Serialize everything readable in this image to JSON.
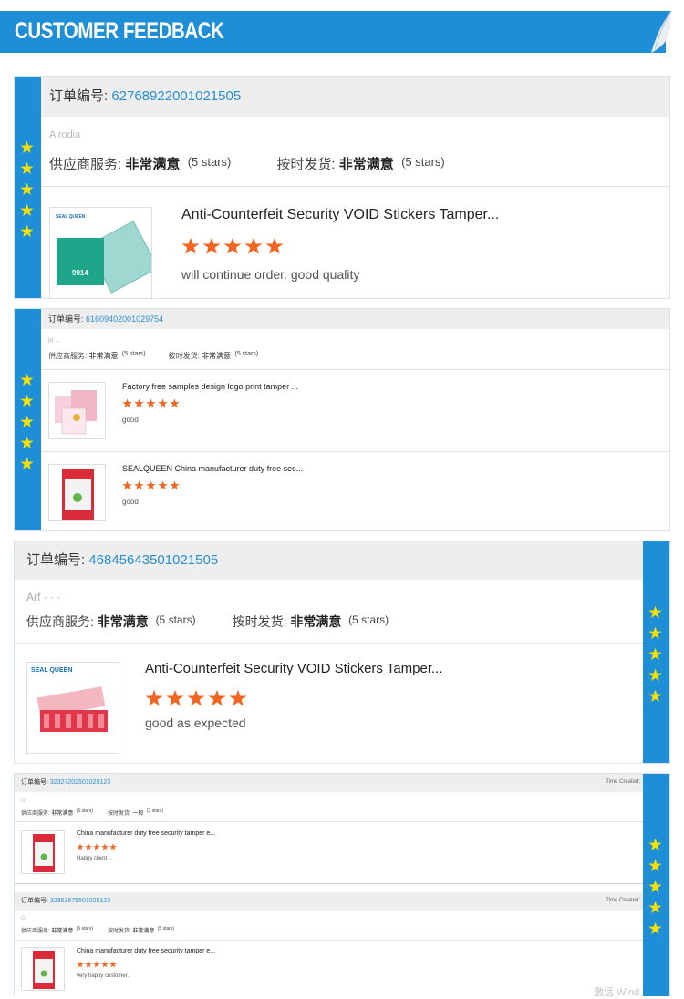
{
  "banner": {
    "title": "CUSTOMER FEEDBACK"
  },
  "labels": {
    "order_label": "订单编号:",
    "supplier_label": "供应商服务:",
    "shipping_label": "按时发货:",
    "very_satisfied": "非常满意",
    "average": "一般",
    "five_stars": "(5 stars)",
    "three_stars": "(3 stars)",
    "time_created": "Time Created:"
  },
  "reviews": [
    {
      "order_no": "62768922001021505",
      "buyer": "A                 rodia",
      "supplier_rating": 5,
      "shipping_rating": 5,
      "items": [
        {
          "title": "Anti-Counterfeit Security VOID Stickers Tamper...",
          "stars": 5,
          "comment": "will continue order. good quality",
          "thumb_text": "SEAL QUEEN",
          "thumb_code": "9914"
        }
      ]
    },
    {
      "order_no": "61609402001029754",
      "buyer": "ja         ...",
      "supplier_rating": 5,
      "shipping_rating": 5,
      "items": [
        {
          "title": "Factory free samples design logo print tamper ...",
          "stars": 5,
          "comment": "good"
        },
        {
          "title": "SEALQUEEN China manufacturer duty free sec...",
          "stars": 5,
          "comment": "good"
        }
      ]
    },
    {
      "order_no": "46845643501021505",
      "buyer": "Arf       ·     ·   ·",
      "supplier_rating": 5,
      "shipping_rating": 5,
      "items": [
        {
          "title": "Anti-Counterfeit Security VOID Stickers Tamper...",
          "stars": 5,
          "comment": "good as expected",
          "thumb_text": "SEAL QUEEN"
        }
      ]
    },
    {
      "order_no": "32327202501025123",
      "buyer": "Gi    ·",
      "supplier_rating": 5,
      "shipping_rating": 3,
      "items": [
        {
          "title": "China manufacturer duty free security tamper e...",
          "stars": 5,
          "comment": "Happy client..."
        }
      ]
    },
    {
      "order_no": "32363675501025123",
      "buyer": "G       ·",
      "supplier_rating": 5,
      "shipping_rating": 5,
      "items": [
        {
          "title": "China manufacturer duty free security tamper e...",
          "stars": 5,
          "comment": "very happy customer."
        }
      ]
    }
  ],
  "watermark": "激活 Wind",
  "colors": {
    "accent": "#1e8fd6",
    "star_orange": "#f26522",
    "side_star": "#f5e100",
    "order_link": "#2a8ed2"
  }
}
